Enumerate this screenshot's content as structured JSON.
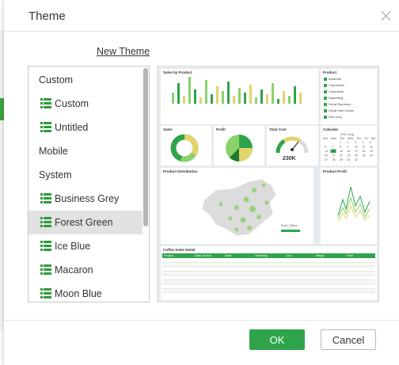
{
  "dialog": {
    "title": "Theme"
  },
  "new_theme_label": "New Theme",
  "theme_list": [
    {
      "label": "Custom",
      "type": "header"
    },
    {
      "label": "Custom",
      "type": "theme"
    },
    {
      "label": "Untitled",
      "type": "theme"
    },
    {
      "label": "Mobile",
      "type": "header"
    },
    {
      "label": "System",
      "type": "header"
    },
    {
      "label": "Business Grey",
      "type": "theme"
    },
    {
      "label": "Forest Green",
      "type": "theme",
      "selected": true
    },
    {
      "label": "Ice Blue",
      "type": "theme"
    },
    {
      "label": "Macaron",
      "type": "theme"
    },
    {
      "label": "Moon Blue",
      "type": "theme"
    }
  ],
  "preview": {
    "sales_by_product": "Sales by Product",
    "product": "Product",
    "product_items": [
      "Amaretto",
      "Chamomile",
      "Colombian",
      "Darjeeling",
      "Decaf Espresso",
      "Decaf Irish Cream",
      "Earl Grey"
    ],
    "sales": "Sales",
    "profit": "Profit",
    "total_cost": "Total Cost",
    "gauge_value": "230K",
    "calendar": "Calendar",
    "calendar_month": "2017 Aug",
    "calendar_days": [
      "Sun",
      "Mon",
      "Tue",
      "Wed",
      "Thu",
      "Fri",
      "Sat"
    ],
    "product_distribution": "Product Distribution",
    "sum_sales": "Sum_Sales",
    "product_profit": "Product Profit",
    "coffee_sales_detail": "Coffee Sales Detail",
    "table_headers": [
      "Product",
      "Sales Amount",
      "Sales",
      "Marketing",
      "Cost",
      "Margin",
      "Profit"
    ]
  },
  "buttons": {
    "ok": "OK",
    "cancel": "Cancel"
  },
  "colors": {
    "accent": "#2fa44a",
    "light_green": "#8bd26b",
    "yellow": "#e3d46b"
  }
}
